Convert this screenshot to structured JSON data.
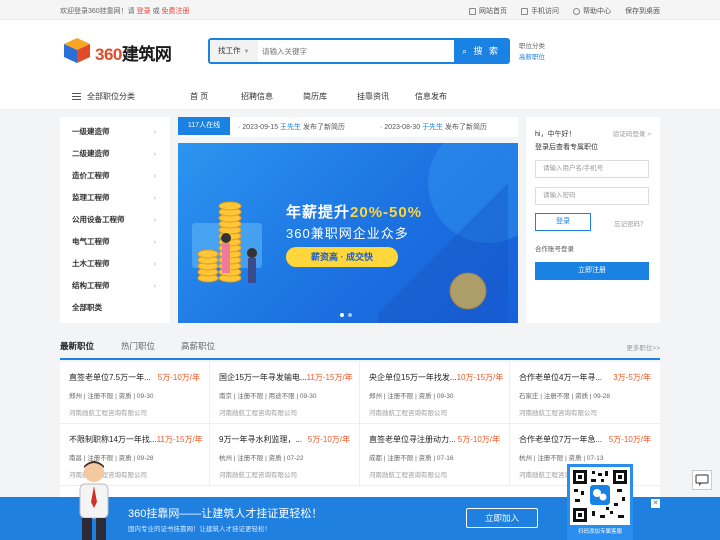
{
  "topbar": {
    "welcome_prefix": "欢迎登录360挂靠网！请",
    "login": "登录",
    "or": "或",
    "register": "免费注册",
    "links": [
      "网站首页",
      "手机访问",
      "帮助中心",
      "保存到桌面"
    ]
  },
  "logo": {
    "num": "360",
    "text": "建筑网"
  },
  "search": {
    "type": "找工作",
    "placeholder": "请输入关键字",
    "button": "搜 索"
  },
  "hotlinks": [
    "职位分类",
    "高薪职位"
  ],
  "nav": {
    "all_categories": "全部职位分类",
    "items": [
      "首 页",
      "招聘信息",
      "简历库",
      "挂靠资讯",
      "信息发布"
    ]
  },
  "categories": [
    "一级建造师",
    "二级建造师",
    "造价工程师",
    "监理工程师",
    "公用设备工程师",
    "电气工程师",
    "土木工程师",
    "结构工程师",
    "全部职类"
  ],
  "ticker": {
    "online": "117人在线",
    "messages": [
      {
        "date": "2023-09-15",
        "name": "王先生",
        "action": "发布了新简历"
      },
      {
        "date": "2023-08-30",
        "name": "于先生",
        "action": "发布了新简历"
      }
    ]
  },
  "banner": {
    "line1_a": "年薪提升",
    "line1_b": "20%-50%",
    "line2": "360兼职网企业众多",
    "pill": "薪资高 · 成交快"
  },
  "login": {
    "greeting": "hi，中午好！",
    "code_login": "验证码登录 >",
    "lead": "登录后查看专属职位",
    "user_placeholder": "请输入用户名/手机号",
    "pwd_placeholder": "请输入密码",
    "login_btn": "登录",
    "forgot": "忘记密码？",
    "combo": "合作账号登录",
    "register_btn": "立即注册"
  },
  "jobs": {
    "tabs": [
      "最新职位",
      "热门职位",
      "高薪职位"
    ],
    "more": "更多职位>>",
    "cards": [
      {
        "title": "直签老单位7.5万一年...",
        "salary": "5万-10万/年",
        "meta": "郑州 | 注册不限 | 资质 | 09-30",
        "company": "河南勋航工程咨询有限公司"
      },
      {
        "title": "国企15万一年寻发输电...",
        "salary": "11万-15万/年",
        "meta": "南京 | 注册不限 | 用途不限 | 09-30",
        "company": "河南勋航工程咨询有限公司"
      },
      {
        "title": "央企单位15万一年找发...",
        "salary": "10万-15万/年",
        "meta": "郑州 | 注册不限 | 资质 | 09-30",
        "company": "河南勋航工程咨询有限公司"
      },
      {
        "title": "合作老单位4万一年寻...",
        "salary": "3万-5万/年",
        "meta": "石家庄 | 注册不限 | 资质 | 09-28",
        "company": "河南勋航工程咨询有限公司"
      },
      {
        "title": "不限制职称14万一年找...",
        "salary": "11万-15万/年",
        "meta": "南昌 | 注册不限 | 资质 | 09-28",
        "company": "河南勋航工程咨询有限公司"
      },
      {
        "title": "9万一年寻水利监理，...",
        "salary": "5万-10万/年",
        "meta": "杭州 | 注册不限 | 资质 | 07-22",
        "company": "河南勋航工程咨询有限公司"
      },
      {
        "title": "直签老单位寻注册动力...",
        "salary": "5万-10万/年",
        "meta": "成都 | 注册不限 | 资质 | 07-16",
        "company": "河南勋航工程咨询有限公司"
      },
      {
        "title": "合作老单位7万一年急...",
        "salary": "5万-10万/年",
        "meta": "杭州 | 注册不限 | 资质 | 07-13",
        "company": "河南勋航工程咨询有限公司"
      }
    ]
  },
  "footbar": {
    "slogan": "360挂靠网——让建筑人才挂证更轻松！",
    "sub": "国内专业的证书挂靠网！让建筑人才挂证更轻松！",
    "join": "立即加入",
    "close": "✕"
  },
  "qr": {
    "caption": "扫码添加专属客服"
  }
}
